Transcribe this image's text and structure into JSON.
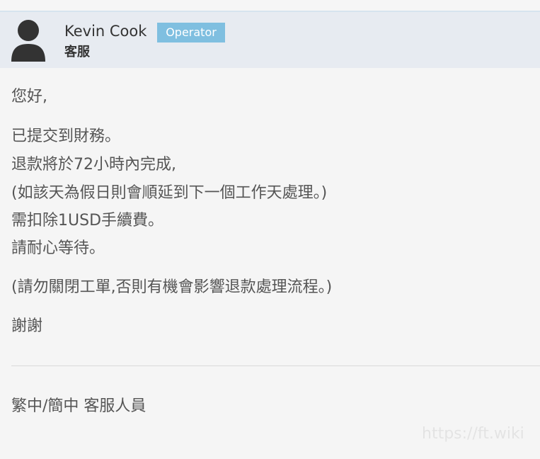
{
  "header": {
    "name": "Kevin Cook",
    "badge": "Operator",
    "role": "客服",
    "avatar_icon": "user-silhouette-icon"
  },
  "message": {
    "greeting": "您好,",
    "lines": [
      "已提交到財務。",
      "退款將於72小時內完成,",
      "(如該天為假日則會順延到下一個工作天處理。)",
      "需扣除1USD手續費。",
      "請耐心等待。"
    ],
    "note": "(請勿關閉工單,否則有機會影響退款處理流程。)",
    "closing": "謝謝"
  },
  "signature": "繁中/簡中 客服人員",
  "watermark": "https://ft.wiki",
  "colors": {
    "header_bg": "#e7ebf1",
    "badge_bg": "#7fbfe0",
    "page_bg": "#f5f5f5"
  }
}
